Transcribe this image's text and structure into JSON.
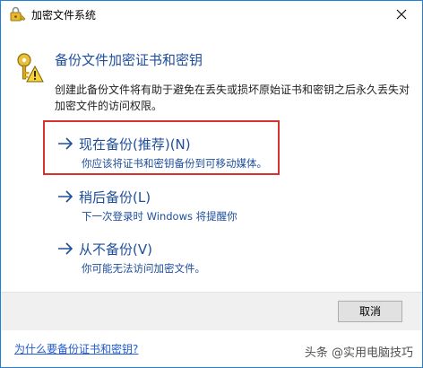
{
  "window": {
    "title": "加密文件系统"
  },
  "header": {
    "heading": "备份文件加密证书和密钥",
    "description": "创建此备份文件将有助于避免在丢失或损坏原始证书和密钥之后永久丢失对加密文件的访问权限。"
  },
  "options": [
    {
      "title": "现在备份(推荐)(N)",
      "subtitle": "你应该将证书和密钥备份到可移动媒体。",
      "highlighted": true
    },
    {
      "title": "稍后备份(L)",
      "subtitle": "下一次登录时 Windows 将提醒你"
    },
    {
      "title": "从不备份(V)",
      "subtitle": "你可能无法访问加密文件。"
    }
  ],
  "footer": {
    "cancel_label": "取消",
    "help_link": "为什么要备份证书和密钥?"
  },
  "watermark": "头条 @实用电脑技巧",
  "colors": {
    "accent": "#1e4e9c",
    "highlight_border": "#d8322f",
    "link": "#1f5bd1",
    "window_border": "#1e80d6"
  },
  "icons": {
    "title": "key-lock-icon",
    "header": "key-warning-icon",
    "option_arrow": "arrow-right-icon",
    "close": "close-icon"
  }
}
